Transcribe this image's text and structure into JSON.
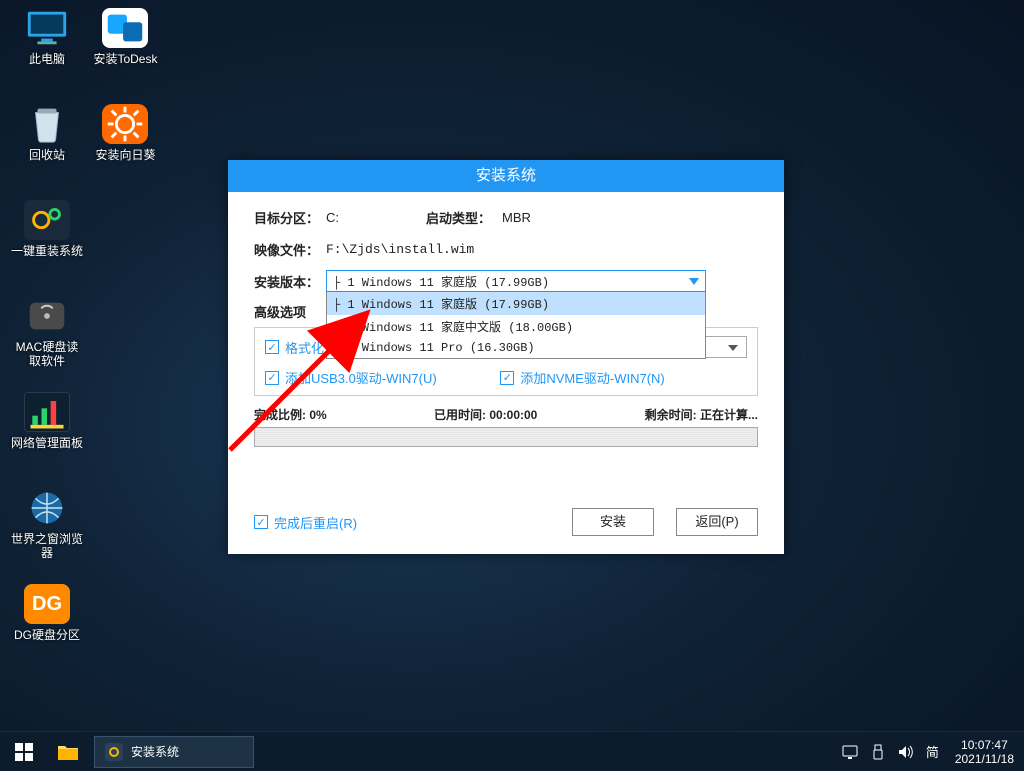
{
  "desktop": {
    "icons_col1": [
      {
        "name": "this-pc",
        "label": "此电脑"
      },
      {
        "name": "recycle-bin",
        "label": "回收站"
      },
      {
        "name": "one-click-reinstall",
        "label": "一键重装系统"
      },
      {
        "name": "mac-disk-reader",
        "label": "MAC硬盘读\n取软件"
      },
      {
        "name": "network-panel",
        "label": "网络管理面板"
      },
      {
        "name": "world-window-browser",
        "label": "世界之窗浏览\n器"
      },
      {
        "name": "dg-partition",
        "label": "DG硬盘分区"
      }
    ],
    "icons_col2": [
      {
        "name": "install-todesk",
        "label": "安装ToDesk"
      },
      {
        "name": "install-sunflower",
        "label": "安装向日葵"
      }
    ]
  },
  "installer": {
    "title": "安装系统",
    "target_label": "目标分区：",
    "target_value": "C:",
    "boot_label": "启动类型：",
    "boot_value": "MBR",
    "image_label": "映像文件：",
    "image_value": "F:\\Zjds\\install.wim",
    "version_label": "安装版本：",
    "version_selected": "├ 1 Windows 11 家庭版 (17.99GB)",
    "version_options": [
      "├ 1 Windows 11 家庭版 (17.99GB)",
      "├ 2 Windows 11 家庭中文版 (18.00GB)",
      "└ 3 Windows 11 Pro (16.30GB)"
    ],
    "advanced_label": "高级选项",
    "format_label": "格式化分区",
    "usb3_label": "添加USB3.0驱动-WIN7(U)",
    "nvme_label": "添加NVME驱动-WIN7(N)",
    "progress_label": "完成比例:",
    "progress_value": "0%",
    "elapsed_label": "已用时间:",
    "elapsed_value": "00:00:00",
    "remaining_label": "剩余时间:",
    "remaining_value": "正在计算...",
    "reboot_label": "完成后重启(R)",
    "install_btn": "安装",
    "back_btn": "返回(P)"
  },
  "taskbar": {
    "task_label": "安装系统",
    "ime": "简",
    "time": "10:07:47",
    "date": "2021/11/18"
  }
}
